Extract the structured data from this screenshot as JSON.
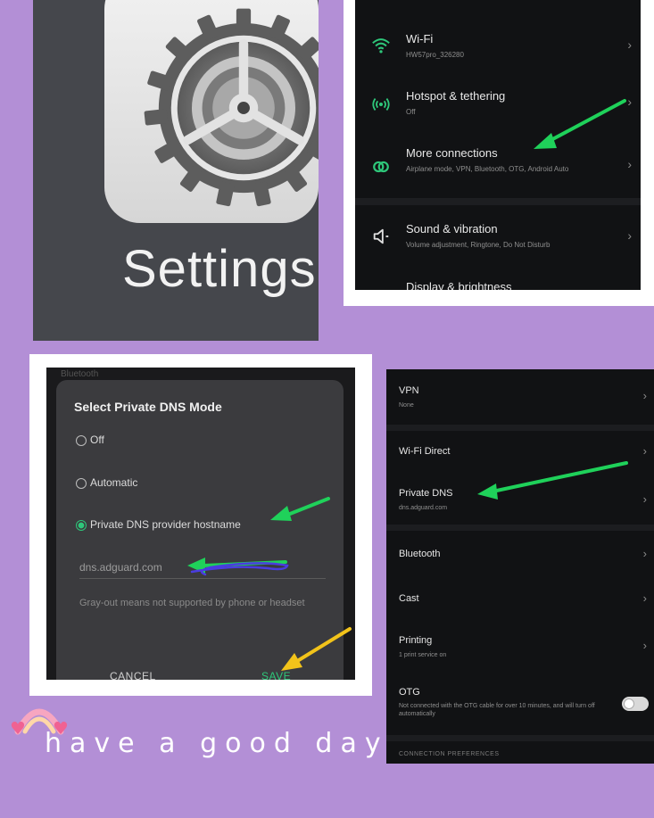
{
  "panel1": {
    "label": "Settings"
  },
  "panel2": {
    "items": [
      {
        "icon": "wifi-icon",
        "title": "Wi-Fi",
        "subtitle": "HW57pro_326280"
      },
      {
        "icon": "hotspot-icon",
        "title": "Hotspot & tethering",
        "subtitle": "Off"
      },
      {
        "icon": "link-icon",
        "title": "More connections",
        "subtitle": "Airplane mode, VPN, Bluetooth, OTG, Android Auto"
      },
      {
        "icon": "speaker-icon",
        "title": "Sound & vibration",
        "subtitle": "Volume adjustment, Ringtone, Do Not Disturb"
      },
      {
        "icon": "brightness-icon",
        "title": "Display & brightness",
        "subtitle": ""
      }
    ]
  },
  "panel3": {
    "background_label": "Bluetooth",
    "dialog_title": "Select Private DNS Mode",
    "options": [
      {
        "label": "Off",
        "selected": false
      },
      {
        "label": "Automatic",
        "selected": false
      },
      {
        "label": "Private DNS provider hostname",
        "selected": true
      }
    ],
    "hostname_value": "dns.adguard.com",
    "note": "Gray-out means not supported by phone or headset",
    "cancel_label": "CANCEL",
    "save_label": "SAVE"
  },
  "panel4": {
    "items": [
      {
        "title": "VPN",
        "subtitle": "None"
      },
      {
        "title": "Wi-Fi Direct",
        "subtitle": ""
      },
      {
        "title": "Private DNS",
        "subtitle": "dns.adguard.com"
      },
      {
        "title": "Bluetooth",
        "subtitle": ""
      },
      {
        "title": "Cast",
        "subtitle": ""
      },
      {
        "title": "Printing",
        "subtitle": "1 print service on"
      },
      {
        "title": "OTG",
        "subtitle": "Not connected with the OTG cable for over 10 minutes, and will turn off automatically"
      }
    ],
    "otg_enabled": false,
    "section_label": "CONNECTION PREFERENCES"
  },
  "caption": "have a good day",
  "colors": {
    "background": "#b38fd6",
    "accent_green": "#2ec77a",
    "arrow_green": "#1fd15a",
    "arrow_yellow": "#f2c31a"
  }
}
